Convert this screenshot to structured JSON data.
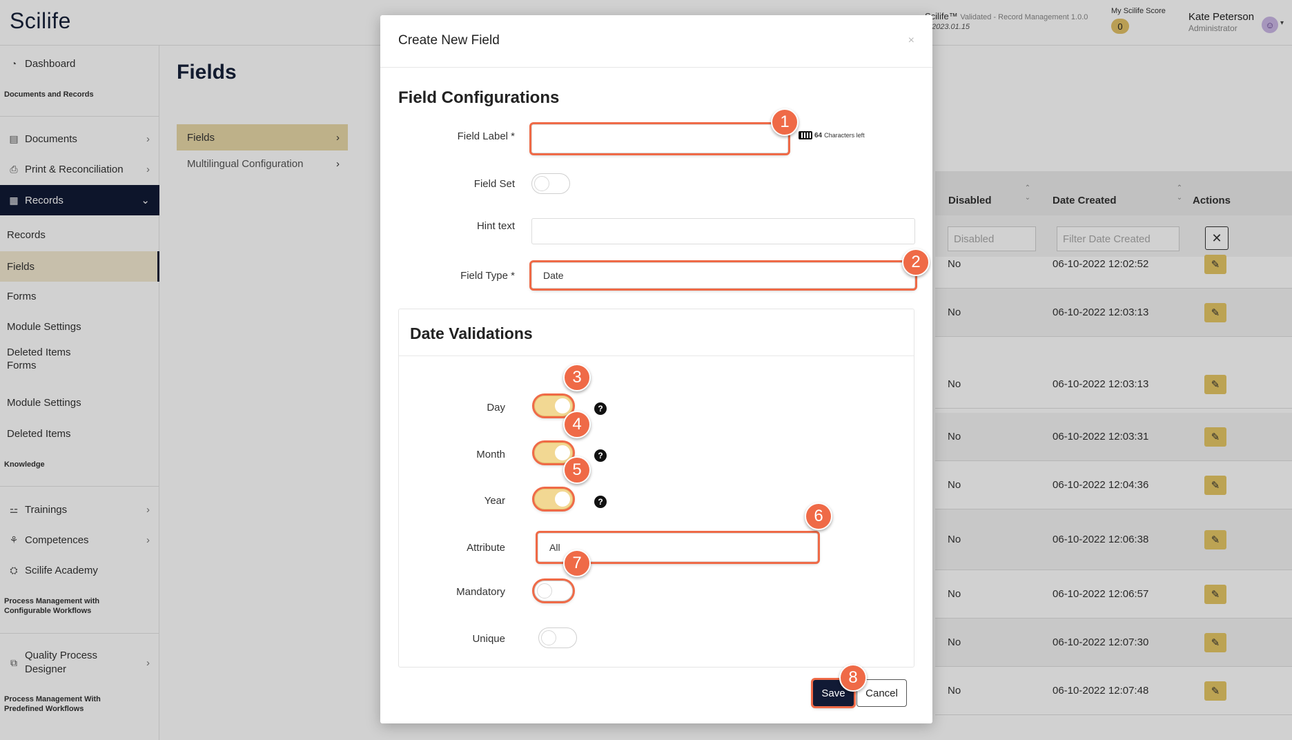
{
  "app": {
    "logo": "Scilife",
    "system_name": "Scilife™",
    "system_status": "Validated - Record Management 1.0.0",
    "system_version": "2023.01.15",
    "score_label": "My Scilife Score",
    "score_value": "0",
    "user_name": "Kate Peterson",
    "user_role": "Administrator"
  },
  "sidebar": {
    "dashboard": "Dashboard",
    "section_docs": "Documents and Records",
    "documents": "Documents",
    "print": "Print & Reconciliation",
    "records": "Records",
    "sub_records": "Records",
    "sub_fields": "Fields",
    "sub_forms": "Forms",
    "sub_module_settings": "Module Settings",
    "sub_deleted_items": "Deleted Items",
    "sub_forms_2": "Forms",
    "sub_module_settings_2": "Module Settings",
    "sub_deleted_items_2": "Deleted Items",
    "section_knowledge": "Knowledge",
    "trainings": "Trainings",
    "competences": "Competences",
    "academy": "Scilife Academy",
    "section_process_1": "Process Management with",
    "section_process_1b": "Configurable Workflows",
    "quality_designer_1": "Quality Process",
    "quality_designer_2": "Designer",
    "section_process_2": "Process Management With",
    "section_process_2b": "Predefined Workflows"
  },
  "page": {
    "title": "Fields",
    "subnav": [
      "Fields",
      "Multilingual Configuration"
    ]
  },
  "table": {
    "headers": {
      "disabled": "Disabled",
      "date_created": "Date Created",
      "actions": "Actions"
    },
    "filters": {
      "disabled": "Disabled",
      "date_created": "Filter Date Created"
    },
    "rows": [
      {
        "disabled": "No",
        "date": "06-10-2022 12:02:52"
      },
      {
        "disabled": "No",
        "date": "06-10-2022 12:03:13"
      },
      {
        "disabled": "No",
        "date": "06-10-2022 12:03:13"
      },
      {
        "disabled": "No",
        "date": "06-10-2022 12:03:31"
      },
      {
        "disabled": "No",
        "date": "06-10-2022 12:04:36"
      },
      {
        "disabled": "No",
        "date": "06-10-2022 12:06:38"
      },
      {
        "disabled": "No",
        "date": "06-10-2022 12:06:57"
      },
      {
        "disabled": "No",
        "date": "06-10-2022 12:07:30"
      },
      {
        "disabled": "No",
        "date": "06-10-2022 12:07:48"
      }
    ]
  },
  "modal": {
    "title": "Create New Field",
    "close": "×",
    "section_title": "Field Configurations",
    "field_label": {
      "label": "Field Label *",
      "value": "",
      "counter_num": "64",
      "counter_text": "Characters left"
    },
    "field_set": {
      "label": "Field Set",
      "on": false
    },
    "hint_text": {
      "label": "Hint text",
      "value": ""
    },
    "field_type": {
      "label": "Field Type *",
      "value": "Date"
    },
    "date_validations": {
      "title": "Date Validations",
      "day": {
        "label": "Day",
        "on": true
      },
      "month": {
        "label": "Month",
        "on": true
      },
      "year": {
        "label": "Year",
        "on": true
      },
      "attribute": {
        "label": "Attribute",
        "value": "All"
      },
      "mandatory": {
        "label": "Mandatory",
        "on": false
      },
      "unique": {
        "label": "Unique",
        "on": false
      }
    },
    "save": "Save",
    "cancel": "Cancel",
    "help_glyph": "?"
  },
  "callouts": [
    "1",
    "2",
    "3",
    "4",
    "5",
    "6",
    "7",
    "8"
  ],
  "colors": {
    "callout": "#ef6a47",
    "primary": "#111a35",
    "accent": "#e6c766"
  }
}
